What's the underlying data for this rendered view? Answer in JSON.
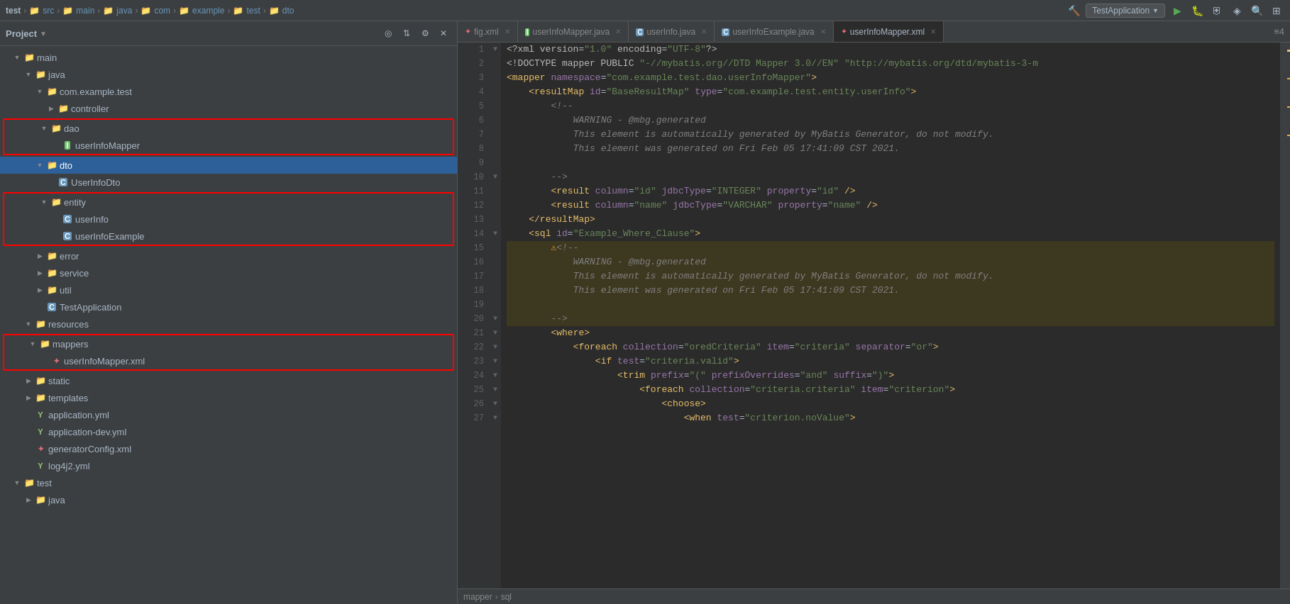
{
  "topbar": {
    "breadcrumb": [
      "test",
      "src",
      "main",
      "java",
      "com",
      "example",
      "test",
      "dto"
    ],
    "runConfig": "TestApplication",
    "icons": [
      "hammer",
      "run",
      "debug",
      "coverage",
      "profile",
      "build",
      "layout"
    ]
  },
  "sidebar": {
    "title": "Project",
    "tree": [
      {
        "id": "main",
        "label": "main",
        "type": "folder",
        "depth": 1,
        "expanded": true,
        "arrow": "▼"
      },
      {
        "id": "java",
        "label": "java",
        "type": "folder",
        "depth": 2,
        "expanded": true,
        "arrow": "▼"
      },
      {
        "id": "com.example.test",
        "label": "com.example.test",
        "type": "folder",
        "depth": 3,
        "expanded": true,
        "arrow": "▼"
      },
      {
        "id": "controller",
        "label": "controller",
        "type": "folder",
        "depth": 4,
        "expanded": false,
        "arrow": "▶"
      },
      {
        "id": "dao",
        "label": "dao",
        "type": "folder",
        "depth": 4,
        "expanded": true,
        "arrow": "▼",
        "boxed": true
      },
      {
        "id": "userInfoMapper",
        "label": "userInfoMapper",
        "type": "java-i",
        "depth": 5,
        "boxed": true
      },
      {
        "id": "dto",
        "label": "dto",
        "type": "folder",
        "depth": 4,
        "expanded": true,
        "arrow": "▼",
        "selected": true
      },
      {
        "id": "UserInfoDto",
        "label": "UserInfoDto",
        "type": "java-c",
        "depth": 5
      },
      {
        "id": "entity",
        "label": "entity",
        "type": "folder",
        "depth": 4,
        "expanded": true,
        "arrow": "▼",
        "boxed": true
      },
      {
        "id": "userInfo",
        "label": "userInfo",
        "type": "java-c",
        "depth": 5,
        "boxed": true
      },
      {
        "id": "userInfoExample",
        "label": "userInfoExample",
        "type": "java-c",
        "depth": 5,
        "boxed": true
      },
      {
        "id": "error",
        "label": "error",
        "type": "folder",
        "depth": 4,
        "expanded": false,
        "arrow": "▶"
      },
      {
        "id": "service",
        "label": "service",
        "type": "folder",
        "depth": 4,
        "expanded": false,
        "arrow": "▶"
      },
      {
        "id": "util",
        "label": "util",
        "type": "folder",
        "depth": 4,
        "expanded": false,
        "arrow": "▶"
      },
      {
        "id": "TestApplication",
        "label": "TestApplication",
        "type": "java-c",
        "depth": 4
      },
      {
        "id": "resources",
        "label": "resources",
        "type": "folder",
        "depth": 2,
        "expanded": true,
        "arrow": "▼"
      },
      {
        "id": "mappers",
        "label": "mappers",
        "type": "folder",
        "depth": 3,
        "expanded": true,
        "arrow": "▼",
        "boxed": true
      },
      {
        "id": "userInfoMapper.xml",
        "label": "userInfoMapper.xml",
        "type": "xml",
        "depth": 4,
        "boxed": true
      },
      {
        "id": "static",
        "label": "static",
        "type": "folder",
        "depth": 3,
        "expanded": false,
        "arrow": "▶"
      },
      {
        "id": "templates",
        "label": "templates",
        "type": "folder",
        "depth": 3,
        "expanded": false,
        "arrow": "▶"
      },
      {
        "id": "application.yml",
        "label": "application.yml",
        "type": "yml",
        "depth": 3
      },
      {
        "id": "application-dev.yml",
        "label": "application-dev.yml",
        "type": "yml",
        "depth": 3
      },
      {
        "id": "generatorConfig.xml",
        "label": "generatorConfig.xml",
        "type": "xml",
        "depth": 3
      },
      {
        "id": "log4j2.yml",
        "label": "log4j2.yml",
        "type": "yml",
        "depth": 3
      },
      {
        "id": "test",
        "label": "test",
        "type": "folder",
        "depth": 1,
        "expanded": true,
        "arrow": "▼"
      },
      {
        "id": "java2",
        "label": "java",
        "type": "folder",
        "depth": 2,
        "expanded": false,
        "arrow": "▶"
      }
    ]
  },
  "tabs": [
    {
      "id": "fig",
      "label": "fig.xml",
      "active": false,
      "type": "xml"
    },
    {
      "id": "userInfoMapper",
      "label": "userInfoMapper.java",
      "active": false,
      "type": "java-i"
    },
    {
      "id": "userInfo",
      "label": "userInfo.java",
      "active": false,
      "type": "java-c"
    },
    {
      "id": "userInfoExample",
      "label": "userInfoExample.java",
      "active": false,
      "type": "java-c"
    },
    {
      "id": "userInfoMapperXml",
      "label": "userInfoMapper.xml",
      "active": true,
      "type": "xml-red"
    },
    {
      "id": "overflow",
      "label": "4",
      "active": false
    }
  ],
  "code": {
    "lines": [
      {
        "n": 1,
        "text": "<?xml version=\"1.0\" encoding=\"UTF-8\"?>",
        "highlight": false
      },
      {
        "n": 2,
        "text": "<!DOCTYPE mapper PUBLIC \"-//mybatis.org//DTD Mapper 3.0//EN\" \"http://mybatis.org/dtd/mybatis-3-m",
        "highlight": false
      },
      {
        "n": 3,
        "text": "<mapper namespace=\"com.example.test.dao.userInfoMapper\">",
        "highlight": false
      },
      {
        "n": 4,
        "text": "    <resultMap id=\"BaseResultMap\" type=\"com.example.test.entity.userInfo\">",
        "highlight": false
      },
      {
        "n": 5,
        "text": "        <!--",
        "highlight": false
      },
      {
        "n": 6,
        "text": "            WARNING - @mbg.generated",
        "highlight": false
      },
      {
        "n": 7,
        "text": "            This element is automatically generated by MyBatis Generator, do not modify.",
        "highlight": false
      },
      {
        "n": 8,
        "text": "            This element was generated on Fri Feb 05 17:41:09 CST 2021.",
        "highlight": false
      },
      {
        "n": 9,
        "text": "",
        "highlight": false
      },
      {
        "n": 10,
        "text": "        -->",
        "highlight": false
      },
      {
        "n": 11,
        "text": "        <result column=\"id\" jdbcType=\"INTEGER\" property=\"id\" />",
        "highlight": false
      },
      {
        "n": 12,
        "text": "        <result column=\"name\" jdbcType=\"VARCHAR\" property=\"name\" />",
        "highlight": false
      },
      {
        "n": 13,
        "text": "    </resultMap>",
        "highlight": false
      },
      {
        "n": 14,
        "text": "    <sql id=\"Example_Where_Clause\">",
        "highlight": false
      },
      {
        "n": 15,
        "text": "        <!--",
        "highlight": true
      },
      {
        "n": 16,
        "text": "            WARNING - @mbg.generated",
        "highlight": true
      },
      {
        "n": 17,
        "text": "            This element is automatically generated by MyBatis Generator, do not modify.",
        "highlight": true
      },
      {
        "n": 18,
        "text": "            This element was generated on Fri Feb 05 17:41:09 CST 2021.",
        "highlight": true
      },
      {
        "n": 19,
        "text": "",
        "highlight": true
      },
      {
        "n": 20,
        "text": "        -->",
        "highlight": true
      },
      {
        "n": 21,
        "text": "        <where>",
        "highlight": false
      },
      {
        "n": 22,
        "text": "            <foreach collection=\"oredCriteria\" item=\"criteria\" separator=\"or\">",
        "highlight": false
      },
      {
        "n": 23,
        "text": "                <if test=\"criteria.valid\">",
        "highlight": false
      },
      {
        "n": 24,
        "text": "                    <trim prefix=\"(\" prefixOverrides=\"and\" suffix=\")\">",
        "highlight": false
      },
      {
        "n": 25,
        "text": "                        <foreach collection=\"criteria.criteria\" item=\"criterion\">",
        "highlight": false
      },
      {
        "n": 26,
        "text": "                            <choose>",
        "highlight": false
      },
      {
        "n": 27,
        "text": "                                <when test=\"criterion.noValue\">",
        "highlight": false
      }
    ]
  },
  "bottomBar": {
    "breadcrumb": [
      "mapper",
      "sql"
    ]
  }
}
